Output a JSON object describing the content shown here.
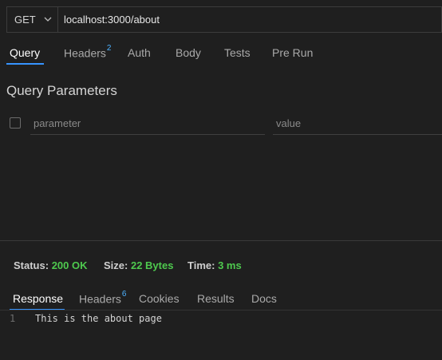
{
  "request": {
    "method": "GET",
    "url": "localhost:3000/about"
  },
  "request_tabs": [
    {
      "label": "Query",
      "badge": "",
      "active": true
    },
    {
      "label": "Headers",
      "badge": "2",
      "active": false
    },
    {
      "label": "Auth",
      "badge": "",
      "active": false
    },
    {
      "label": "Body",
      "badge": "",
      "active": false
    },
    {
      "label": "Tests",
      "badge": "",
      "active": false
    },
    {
      "label": "Pre Run",
      "badge": "",
      "active": false
    }
  ],
  "query": {
    "title": "Query Parameters",
    "param_placeholder": "parameter",
    "value_placeholder": "value"
  },
  "status": {
    "status_label": "Status:",
    "status_value": "200 OK",
    "size_label": "Size:",
    "size_value": "22 Bytes",
    "time_label": "Time:",
    "time_value": "3 ms",
    "value_color": "#4ec94e"
  },
  "response_tabs": [
    {
      "label": "Response",
      "badge": "",
      "active": true
    },
    {
      "label": "Headers",
      "badge": "6",
      "active": false
    },
    {
      "label": "Cookies",
      "badge": "",
      "active": false
    },
    {
      "label": "Results",
      "badge": "",
      "active": false
    },
    {
      "label": "Docs",
      "badge": "",
      "active": false
    }
  ],
  "response": {
    "line_number": "1",
    "body": "This is the about page"
  },
  "colors": {
    "accent": "#3794ff",
    "badge": "#4db2ff",
    "background": "#1f1f1f"
  },
  "icons": {
    "method_dropdown": "chevron-down-icon",
    "row_checkbox": "checkbox-icon"
  }
}
